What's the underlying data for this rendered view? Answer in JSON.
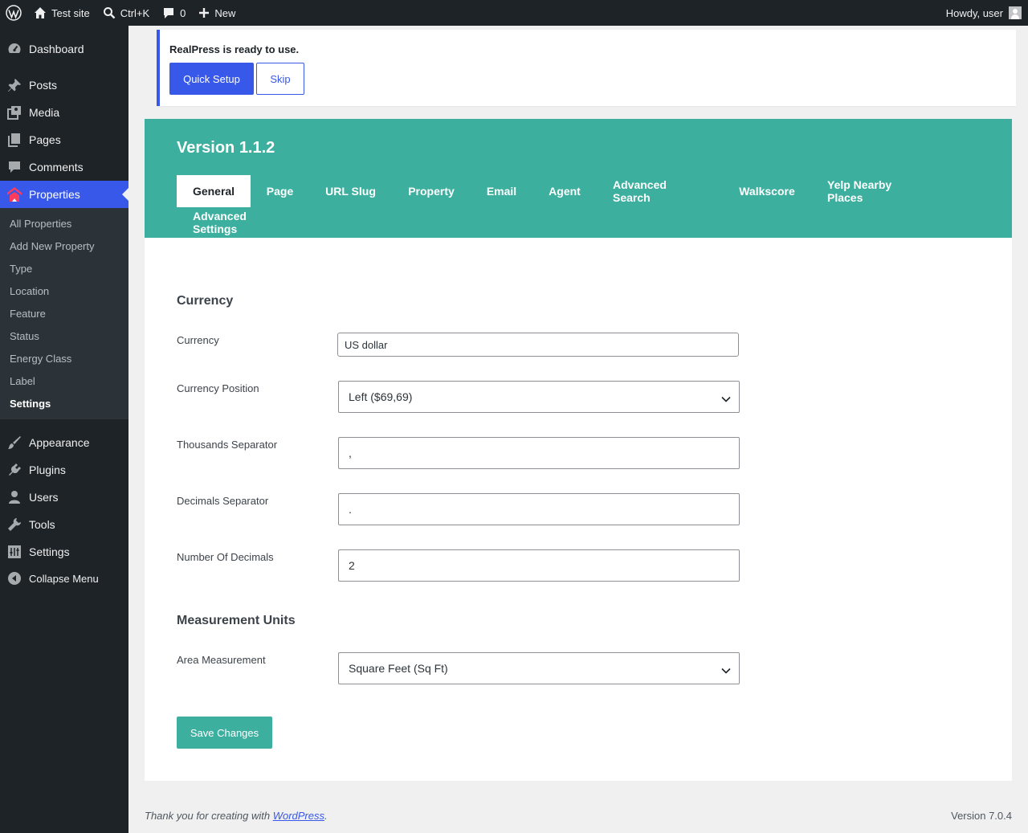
{
  "adminbar": {
    "site_name": "Test site",
    "search_shortcut": "Ctrl+K",
    "comments_count": "0",
    "new_label": "New",
    "howdy": "Howdy, user"
  },
  "sidebar": {
    "items": [
      {
        "label": "Dashboard",
        "icon": "dashboard-icon"
      },
      {
        "label": "Posts",
        "icon": "pin-icon"
      },
      {
        "label": "Media",
        "icon": "media-icon"
      },
      {
        "label": "Pages",
        "icon": "pages-icon"
      },
      {
        "label": "Comments",
        "icon": "comment-icon"
      },
      {
        "label": "Properties",
        "icon": "realpress-icon"
      },
      {
        "label": "Appearance",
        "icon": "brush-icon"
      },
      {
        "label": "Plugins",
        "icon": "plugin-icon"
      },
      {
        "label": "Users",
        "icon": "user-icon"
      },
      {
        "label": "Tools",
        "icon": "wrench-icon"
      },
      {
        "label": "Settings",
        "icon": "settings-icon"
      },
      {
        "label": "Collapse Menu",
        "icon": "collapse-icon"
      }
    ],
    "submenu": [
      "All Properties",
      "Add New Property",
      "Type",
      "Location",
      "Feature",
      "Status",
      "Energy Class",
      "Label",
      "Settings"
    ]
  },
  "notice": {
    "text": "RealPress is ready to use.",
    "quick_setup": "Quick Setup",
    "skip": "Skip"
  },
  "header": {
    "version": "Version 1.1.2",
    "tabs": [
      "General",
      "Page",
      "URL Slug",
      "Property",
      "Email",
      "Agent",
      "Advanced Search",
      "Walkscore",
      "Yelp Nearby Places",
      "Advanced Settings"
    ],
    "active_tab": "General",
    "accent_color": "#3caf9f"
  },
  "form": {
    "currency_section": "Currency",
    "currency_label": "Currency",
    "currency_value": "US dollar",
    "position_label": "Currency Position",
    "position_value": "Left ($69,69)",
    "thousands_label": "Thousands Separator",
    "thousands_value": ",",
    "decimals_label": "Decimals Separator",
    "decimals_value": ".",
    "num_decimals_label": "Number Of Decimals",
    "num_decimals_value": "2",
    "measurement_section": "Measurement Units",
    "area_label": "Area Measurement",
    "area_value": "Square Feet (Sq Ft)",
    "save_label": "Save Changes"
  },
  "footer": {
    "thanks_prefix": "Thank you for creating with ",
    "wordpress_link": "WordPress",
    "thanks_suffix": ".",
    "version": "Version 7.0.4"
  }
}
